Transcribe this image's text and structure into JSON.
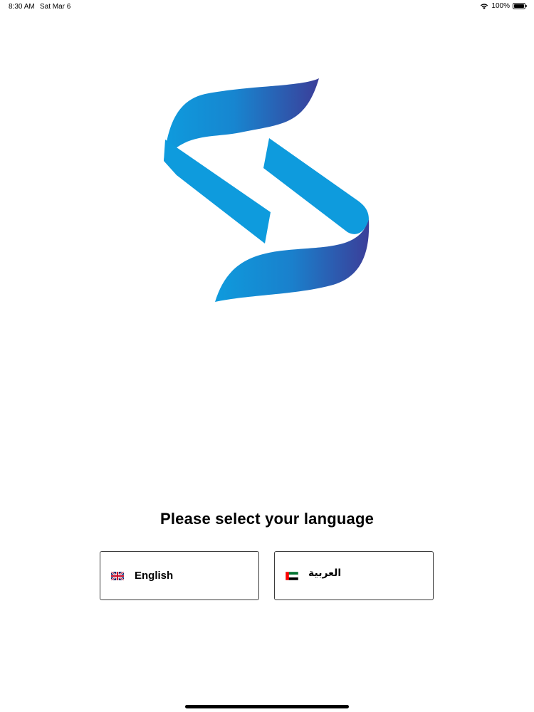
{
  "status_bar": {
    "time": "8:30 AM",
    "date": "Sat Mar 6",
    "battery": "100%",
    "icons": [
      "wifi-icon",
      "battery-icon"
    ]
  },
  "logo": {
    "icon": "brand-logo-icon",
    "colors": {
      "light_blue": "#0E9BDD",
      "dark_blue": "#3B3E99"
    }
  },
  "language_select": {
    "prompt": "Please select your language",
    "options": [
      {
        "label": "English",
        "flag": "uk-flag-icon"
      },
      {
        "label": "العربية",
        "flag": "uae-flag-icon"
      }
    ]
  }
}
